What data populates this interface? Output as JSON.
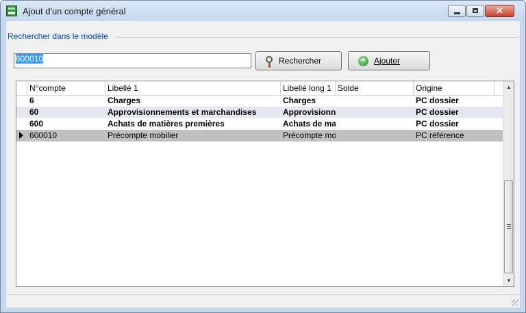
{
  "window": {
    "title": "Ajout d'un compte général"
  },
  "search": {
    "group_label": "Rechercher dans le modèle",
    "value": "600010",
    "search_label": "Rechercher",
    "add_label": "Ajouter"
  },
  "grid": {
    "headers": [
      "N°compte",
      "Libellé 1",
      "Libellé long 1",
      "Solde",
      "Origine"
    ],
    "rows": [
      {
        "compte": "6",
        "libelle": "Charges",
        "libelle_long": "Charges",
        "solde": "",
        "origine": "PC dossier"
      },
      {
        "compte": "60",
        "libelle": "Approvisionnements et marchandises",
        "libelle_long": "Approvisionnements et marchandises",
        "solde": "",
        "origine": "PC dossier"
      },
      {
        "compte": "600",
        "libelle": "Achats de matières premières",
        "libelle_long": "Achats de matières premières",
        "solde": "",
        "origine": "PC dossier"
      },
      {
        "compte": "600010",
        "libelle": "Précompte mobilier",
        "libelle_long": "Précompte mobilier",
        "solde": "",
        "origine": "PC référence"
      }
    ]
  },
  "colors": {
    "title_bar": "#c3d7ee",
    "group_label": "#0046d5",
    "selection": "#3399ff",
    "alt_row": "#e4e6f2",
    "selected_row": "#c0c0c0",
    "close_button": "#c8452d"
  },
  "icons": {
    "app": "accounting-app-icon",
    "search": "magnifier-icon",
    "add": "green-arrow-icon"
  }
}
